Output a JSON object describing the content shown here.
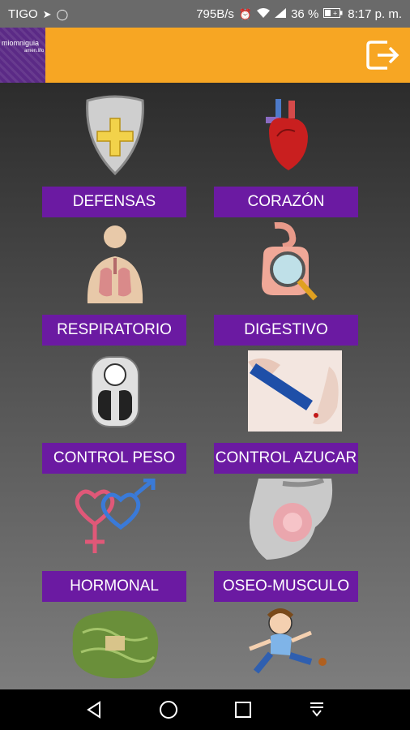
{
  "status_bar": {
    "carrier": "TIGO",
    "speed": "795B/s",
    "battery": "36 %",
    "time": "8:17 p. m.",
    "icons": [
      "navigation-icon",
      "whatsapp-icon",
      "alarm-icon",
      "wifi-icon",
      "signal-icon",
      "battery-icon"
    ]
  },
  "app_bar": {
    "logo_text_1": "miomniguia",
    "logo_text_2": "amen.lifo",
    "exit_icon": "exit-icon",
    "color": "#f7a623"
  },
  "menu": {
    "button_color": "#6b1aa2",
    "items": [
      {
        "label": "DEFENSAS",
        "icon": "shield-icon"
      },
      {
        "label": "CORAZÓN",
        "icon": "heart-icon"
      },
      {
        "label": "RESPIRATORIO",
        "icon": "lungs-icon"
      },
      {
        "label": "DIGESTIVO",
        "icon": "intestine-icon"
      },
      {
        "label": "CONTROL PESO",
        "icon": "scale-icon"
      },
      {
        "label": "CONTROL AZUCAR",
        "icon": "glucose-pen-icon"
      },
      {
        "label": "HORMONAL",
        "icon": "gender-symbols-icon"
      },
      {
        "label": "OSEO-MUSCULO",
        "icon": "knee-pain-icon"
      },
      {
        "label": "",
        "icon": "brain-icon"
      },
      {
        "label": "",
        "icon": "running-child-icon"
      }
    ]
  },
  "nav_bar": {
    "buttons": [
      "back-icon",
      "home-icon",
      "recents-icon",
      "collapse-icon"
    ]
  }
}
